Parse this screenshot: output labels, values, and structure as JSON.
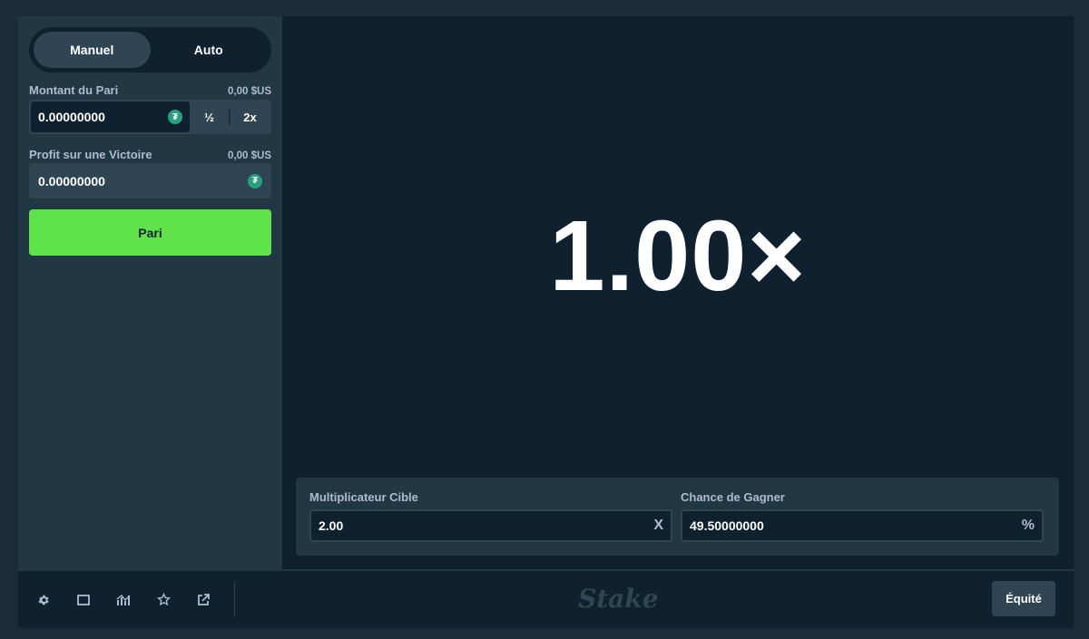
{
  "sidebar": {
    "tabs": [
      {
        "label": "Manuel",
        "active": true
      },
      {
        "label": "Auto",
        "active": false
      }
    ],
    "bet_amount": {
      "label": "Montant du Pari",
      "usd": "0,00 $US",
      "value": "0.00000000",
      "half_label": "½",
      "double_label": "2x",
      "currency_icon": "tether-coin-icon"
    },
    "profit": {
      "label": "Profit sur une Victoire",
      "usd": "0,00 $US",
      "value": "0.00000000",
      "currency_icon": "tether-coin-icon"
    },
    "bet_button_label": "Pari"
  },
  "game": {
    "multiplier": "1.00×",
    "target_multiplier": {
      "label": "Multiplicateur Cible",
      "value": "2.00",
      "unit": "X"
    },
    "win_chance": {
      "label": "Chance de Gagner",
      "value": "49.50000000",
      "unit": "%"
    }
  },
  "footer": {
    "icons": [
      "settings-icon",
      "theatre-mode-icon",
      "live-stats-icon",
      "favorite-star-icon",
      "popout-icon"
    ],
    "logo": "Stake",
    "fairness_label": "Équité"
  },
  "colors": {
    "background": "#1a2c38",
    "panel": "#213743",
    "dark": "#0f212e",
    "accent_green": "#5fe34a",
    "muted_text": "#b1bad3"
  }
}
